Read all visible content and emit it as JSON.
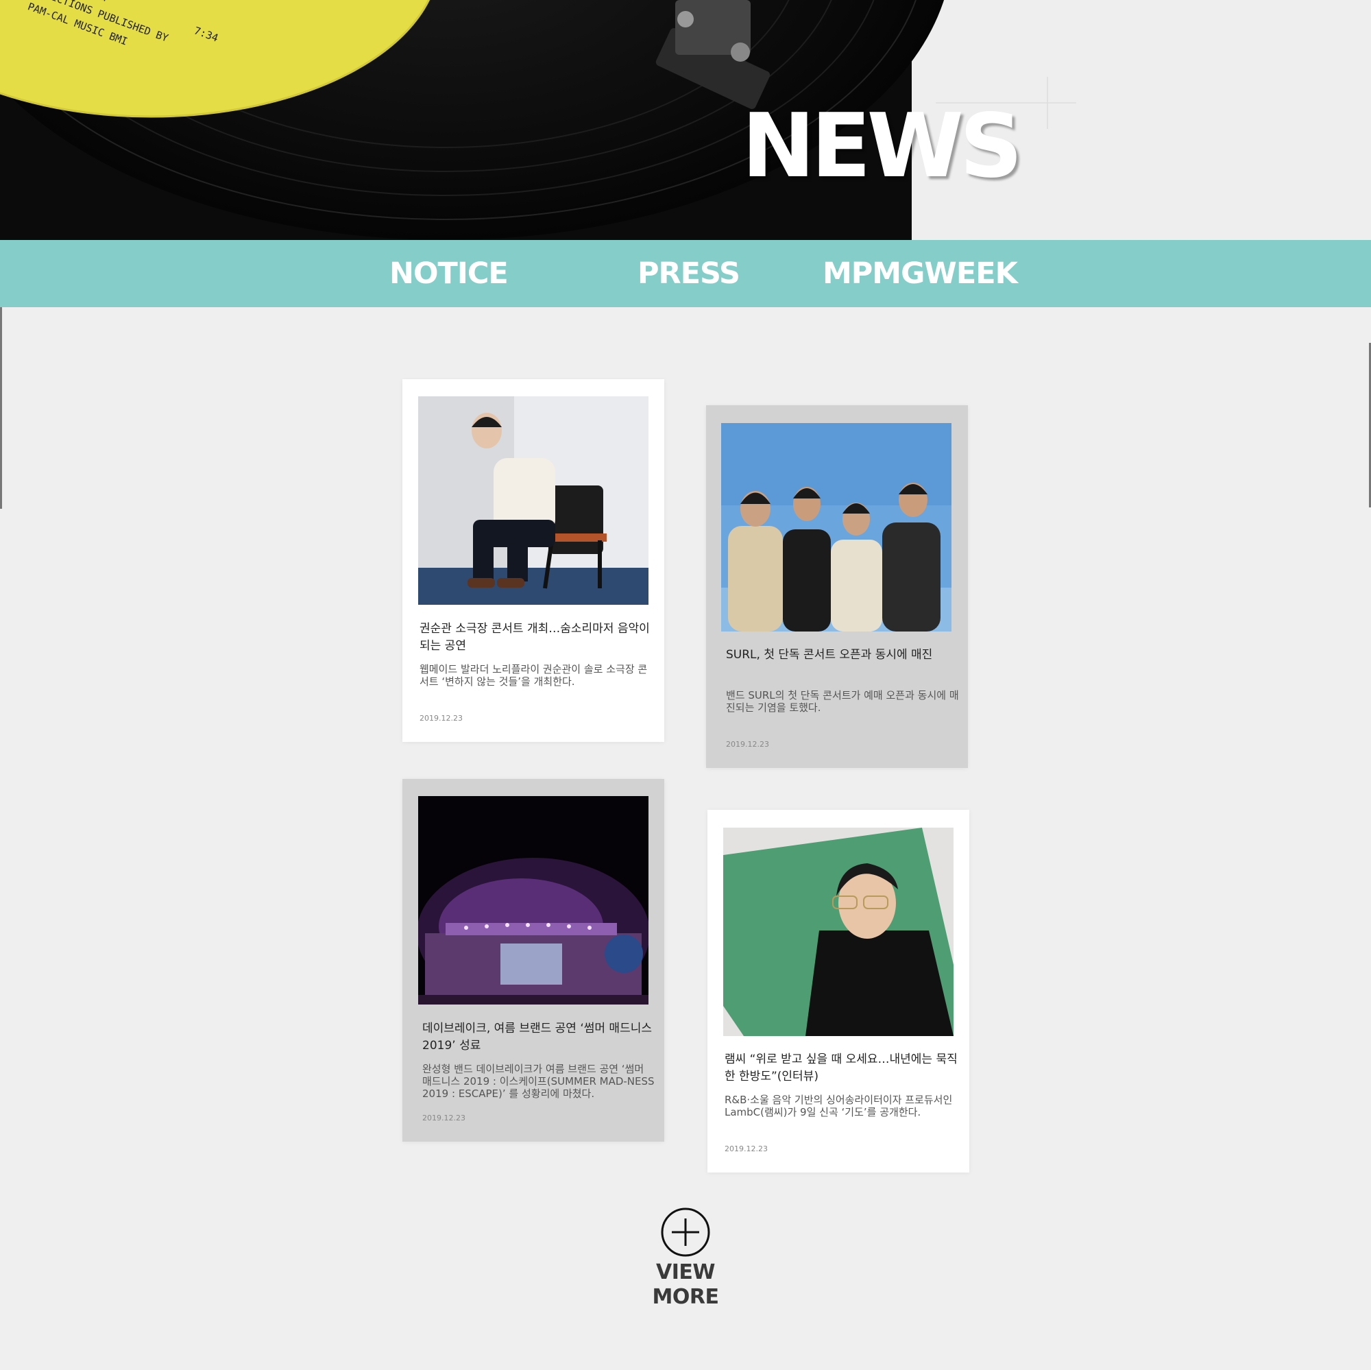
{
  "hero": {
    "title": "NEWS"
  },
  "nav": {
    "items": [
      {
        "label": "NOTICE"
      },
      {
        "label": "PRESS"
      },
      {
        "label": "MPMGWEEK"
      }
    ]
  },
  "colors": {
    "nav_bg": "#85cdc8",
    "page_bg": "#efefef",
    "card_gray": "#d2d2d2"
  },
  "cards": [
    {
      "title": "권순관 소극장 콘서트 개최…숨소리마저 음악이 되는 공연",
      "desc": "웹메이드 발라더 노리플라이 권순관이 솔로 소극장 콘서트 ‘변하지 않는 것들’을 개최한다.",
      "date": "2019.12.23",
      "image": "man-seated-chair-photo"
    },
    {
      "title": "SURL, 첫 단독 콘서트 오픈과 동시에 매진",
      "desc": "밴드 SURL의 첫 단독 콘서트가 예매 오픈과 동시에 매진되는 기염을 토했다.",
      "date": "2019.12.23",
      "image": "band-sky-photo"
    },
    {
      "title": "데이브레이크, 여름 브랜드 공연 ‘썸머 매드니스 2019’ 성료",
      "desc": "완성형 밴드 데이브레이크가 여름 브랜드 공연 ‘썸머 매드니스 2019 : 이스케이프(SUMMER MAD-NESS 2019 : ESCAPE)’ 를 성황리에 마쳤다.",
      "date": "2019.12.23",
      "image": "concert-stage-photo"
    },
    {
      "title": "램씨 “위로 받고 싶을 때 오세요…내년에는 묵직한 한방도”(인터뷰)",
      "desc": "R&B·소울 음악 기반의 싱어송라이터이자 프로듀서인 LambC(램씨)가 9일 신곡 ‘기도’를 공개한다.",
      "date": "2019.12.23",
      "image": "man-green-background-photo"
    }
  ],
  "more": {
    "label": "VIEW MORE",
    "icon": "plus-circle-icon"
  }
}
